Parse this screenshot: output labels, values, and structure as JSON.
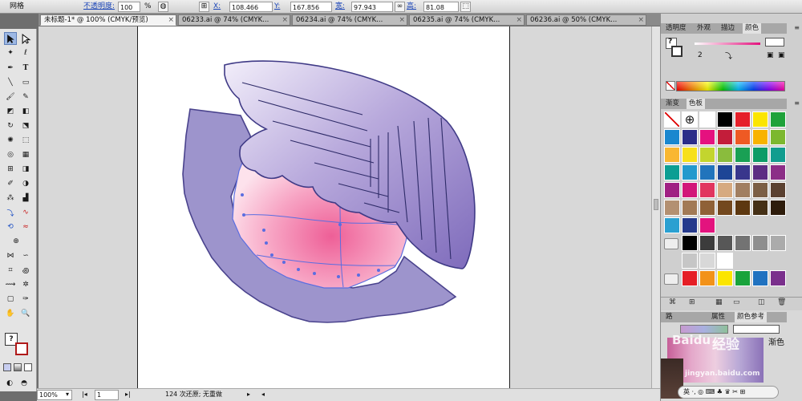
{
  "control_bar": {
    "mode_label": "网格",
    "opacity_label": "不透明度:",
    "opacity_value": "100",
    "percent": "%",
    "x_label": "X:",
    "x_value": "108.466 mm",
    "y_label": "Y:",
    "y_value": "167.856 mm",
    "w_label": "宽:",
    "w_value": "97.943 mm",
    "h_label": "高:",
    "h_value": "81.08 mm"
  },
  "tabs": [
    {
      "label": "未标题-1* @ 100% (CMYK/预览)",
      "active": true
    },
    {
      "label": "06233.ai @ 74% (CMYK...",
      "active": false
    },
    {
      "label": "06234.ai @ 74% (CMYK...",
      "active": false
    },
    {
      "label": "06235.ai @ 74% (CMYK...",
      "active": false
    },
    {
      "label": "06236.ai @ 50% (CMYK...",
      "active": false
    }
  ],
  "tab_close_glyph": "×",
  "status_bar": {
    "zoom": "100%",
    "artboard": "1",
    "history": "124 次还原; 无重做"
  },
  "panels": {
    "top_tabs": [
      "透明度",
      "外观",
      "描边",
      "颜色"
    ],
    "color_help": "?",
    "color_number": "2",
    "mid_tabs": [
      "渐变",
      "色板"
    ],
    "lower_tabs": [
      "路",
      "属性",
      "颜色参考"
    ],
    "lower_label": "渐色",
    "ime_text": "英 ·, ◎ ⌨ ♣ ♛ ✂ ⊞"
  },
  "swatch_colors": [
    [
      "none",
      "reg",
      "#ffffff",
      "#000000",
      "#e5202a",
      "#fbe500",
      "#1fa23a"
    ],
    [
      "#1a87cf",
      "#2b2d89",
      "#e5117f",
      "#c31d3a",
      "#ee5a24",
      "#f8b300",
      "#7cb82f"
    ],
    [
      "#f9b731",
      "#f7e01a",
      "#c3d52e",
      "#8abc3d",
      "#19a054",
      "#0d9b67",
      "#119d8f"
    ],
    [
      "#0c9e93",
      "#2399cd",
      "#2174bc",
      "#1d4596",
      "#39368c",
      "#5d2d83",
      "#8c2e87"
    ],
    [
      "#a02083",
      "#d21679",
      "#e1355f",
      "#d6aa80",
      "#a17f61",
      "#7b5e45",
      "#5b4131"
    ],
    [
      "#b39071",
      "#a27a56",
      "#8f6137",
      "#73481e",
      "#5d3810",
      "#453016",
      "#2e1c0b"
    ],
    [
      "#2aa0d1",
      "#263a8c",
      "#e3137e"
    ],
    [
      "folder",
      "#000000",
      "#3c3c3c",
      "#575757",
      "#737373",
      "#8e8e8e",
      "#ababab"
    ],
    [
      "",
      "#c6c6c6",
      "#d8d8d8",
      "#ffffff"
    ],
    [
      "folder",
      "#e51e25",
      "#f29219",
      "#fbe500",
      "#19a33b",
      "#2072c0",
      "#7a2f8c"
    ]
  ],
  "watermark": {
    "brand": "Baidu",
    "cn": "经验",
    "url": "jingyan.baidu.com"
  }
}
